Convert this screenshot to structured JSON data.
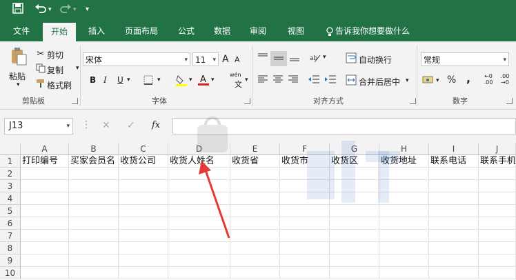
{
  "quick_access": {
    "save_icon": "save-icon",
    "undo_icon": "undo-icon",
    "redo_icon": "redo-icon",
    "customize_icon": "customize-icon"
  },
  "tabs": [
    "文件",
    "开始",
    "插入",
    "页面布局",
    "公式",
    "数据",
    "审阅",
    "视图"
  ],
  "tell_me": "告诉我你想要做什么",
  "clipboard": {
    "paste": "粘贴",
    "cut": "剪切",
    "copy": "复制",
    "format_painter": "格式刷",
    "group": "剪贴板"
  },
  "font": {
    "name": "宋体",
    "size": "11",
    "group": "字体",
    "bold": "B",
    "italic": "I",
    "underline": "U",
    "grow": "A",
    "shrink": "A",
    "phonetic": "wén"
  },
  "alignment": {
    "wrap": "自动换行",
    "merge": "合并后居中",
    "group": "对齐方式"
  },
  "number": {
    "format": "常规",
    "group": "数字",
    "percent": "%",
    "comma": ","
  },
  "name_box": "J13",
  "formula_fx": "fx",
  "columns": [
    "A",
    "B",
    "C",
    "D",
    "E",
    "F",
    "G",
    "H",
    "I",
    "J"
  ],
  "rows": [
    "1",
    "2",
    "3",
    "4",
    "5",
    "6",
    "7",
    "8",
    "9",
    "10"
  ],
  "row1": [
    "打印编号",
    "买家会员名",
    "收货公司",
    "收货人姓名",
    "收货省",
    "收货市",
    "收货区",
    "收货地址",
    "联系电话",
    "联系手机"
  ],
  "colors": {
    "brand": "#217346",
    "arrow": "#e53935"
  }
}
